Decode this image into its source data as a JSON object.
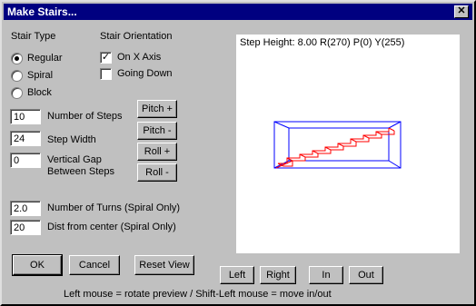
{
  "window": {
    "title": "Make Stairs...",
    "close_glyph": "✕"
  },
  "stair_type": {
    "heading": "Stair Type",
    "options": [
      "Regular",
      "Spiral",
      "Block"
    ],
    "selected": "Regular"
  },
  "orientation": {
    "heading": "Stair Orientation",
    "on_x_axis": {
      "label": "On X Axis",
      "checked": true
    },
    "going_down": {
      "label": "Going Down",
      "checked": false
    }
  },
  "fields": {
    "steps": {
      "value": "10",
      "label": "Number of Steps"
    },
    "width": {
      "value": "24",
      "label": "Step Width"
    },
    "gap": {
      "value": "0",
      "label_line1": "Vertical Gap",
      "label_line2": "Between Steps"
    },
    "turns": {
      "value": "2.0",
      "label": "Number of Turns (Spiral Only)"
    },
    "dist": {
      "value": "20",
      "label": "Dist from center (Spiral Only)"
    }
  },
  "rotation_buttons": {
    "pitch_plus": "Pitch +",
    "pitch_minus": "Pitch -",
    "roll_plus": "Roll +",
    "roll_minus": "Roll -"
  },
  "actions": {
    "ok": "OK",
    "cancel": "Cancel",
    "reset_view": "Reset View"
  },
  "view_buttons": {
    "left": "Left",
    "right": "Right",
    "in": "In",
    "out": "Out"
  },
  "preview": {
    "info": "Step Height: 8.00 R(270) P(0) Y(255)",
    "box_color": "#0000ff",
    "stairs_color": "#ff0000"
  },
  "hint": "Left mouse = rotate preview  / Shift-Left mouse = move in/out"
}
